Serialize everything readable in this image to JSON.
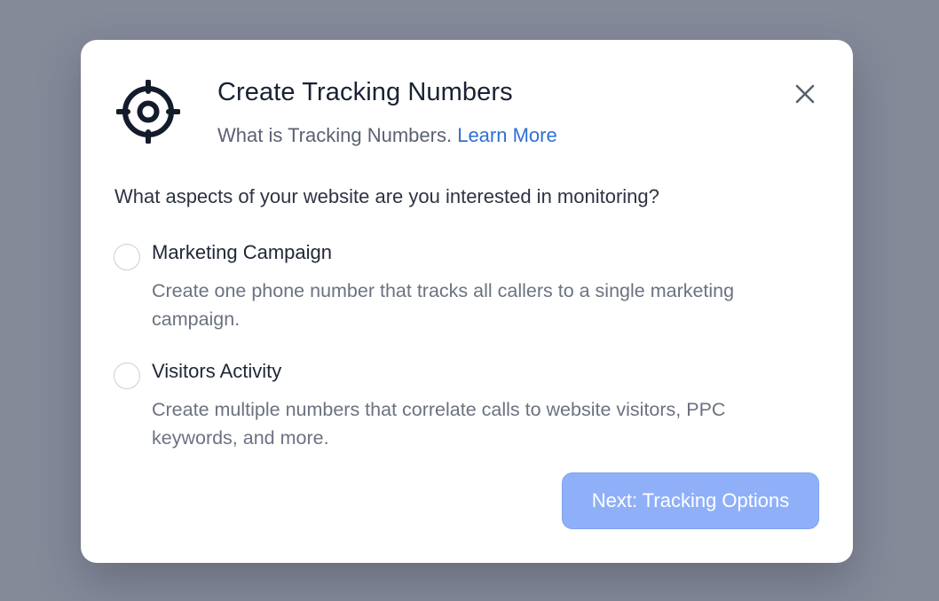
{
  "dialog": {
    "icon": "crosshair-target-icon",
    "title": "Create Tracking Numbers",
    "subtitle_text": "What is Tracking Numbers.",
    "learn_more_label": "Learn More",
    "close_icon": "close-icon",
    "question": "What aspects of your website are you interested in monitoring?",
    "options": [
      {
        "label": "Marketing Campaign",
        "description": "Create one phone number that tracks all callers to a single marketing campaign.",
        "selected": false
      },
      {
        "label": "Visitors Activity",
        "description": "Create multiple numbers that correlate calls to website visitors, PPC keywords, and more.",
        "selected": false
      }
    ],
    "next_button_label": "Next: Tracking Options"
  },
  "colors": {
    "backdrop": "#858a99",
    "dialog_background": "#ffffff",
    "title": "#1a2134",
    "link": "#2f6fd6",
    "primary_button_disabled": "#8fb0f8",
    "muted_text": "#6b7280"
  }
}
